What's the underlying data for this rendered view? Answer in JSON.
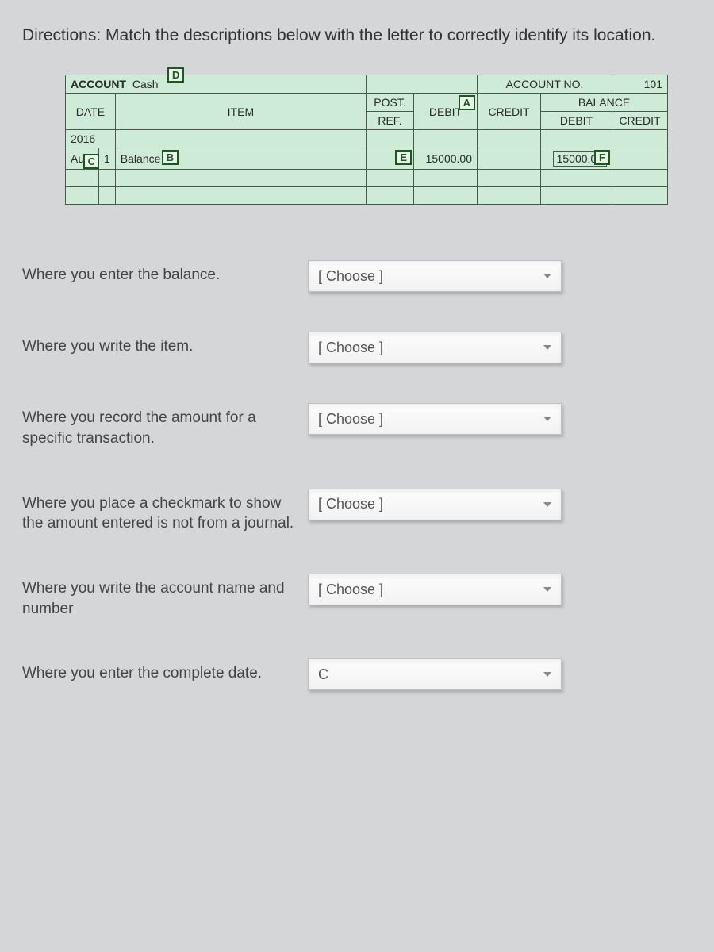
{
  "directions": "Directions:  Match the descriptions below with the letter to correctly identify its location.",
  "ledger": {
    "account_label": "ACCOUNT",
    "account_name": "Cash",
    "account_no_label": "ACCOUNT NO.",
    "account_no": "101",
    "headers": {
      "date": "DATE",
      "item": "ITEM",
      "post_ref": "POST. REF.",
      "debit": "DEBIT",
      "credit": "CREDIT",
      "balance": "BALANCE",
      "bal_debit": "DEBIT",
      "bal_credit": "CREDIT"
    },
    "row": {
      "year": "2016",
      "month": "Aug",
      "day": "1",
      "item": "Balance",
      "post_ref": "✓",
      "debit": "15000.00",
      "credit": "",
      "bal_debit": "15000.00",
      "bal_credit": ""
    },
    "tags": {
      "A": "A",
      "B": "B",
      "C": "C",
      "D": "D",
      "E": "E",
      "F": "F"
    }
  },
  "choose_placeholder": "[ Choose ]",
  "questions": [
    {
      "text": "Where you enter the balance.",
      "selected": "[ Choose ]"
    },
    {
      "text": "Where you write the item.",
      "selected": "[ Choose ]"
    },
    {
      "text": "Where you record the amount for a specific transaction.",
      "selected": "[ Choose ]"
    },
    {
      "text": "Where you place a checkmark to show the amount entered is not from a journal.",
      "selected": "[ Choose ]"
    },
    {
      "text": "Where you write the account name and number",
      "selected": "[ Choose ]"
    },
    {
      "text": "Where you enter the complete date.",
      "selected": "C"
    }
  ]
}
